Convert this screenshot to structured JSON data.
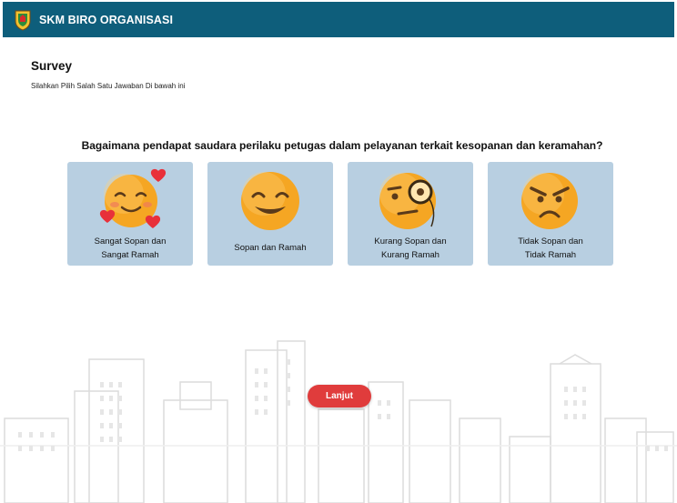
{
  "header": {
    "title": "SKM BIRO ORGANISASI",
    "logo_icon": "shield-logo-icon",
    "background": "#0e5e7b"
  },
  "survey": {
    "title": "Survey",
    "subtitle": "Silahkan Pilih Salah Satu Jawaban Di bawah ini",
    "question": "Bagaimana pendapat saudara perilaku petugas dalam pelayanan terkait kesopanan dan keramahan?"
  },
  "options": [
    {
      "line1": "Sangat Sopan dan",
      "line2": "Sangat Ramah",
      "icon": "smiling-face-with-hearts-icon"
    },
    {
      "line1": "Sopan dan Ramah",
      "icon": "smiling-face-icon"
    },
    {
      "line1": "Kurang Sopan dan",
      "line2": "Kurang Ramah",
      "icon": "face-with-monocle-icon"
    },
    {
      "line1": "Tidak Sopan dan",
      "line2": "Tidak Ramah",
      "icon": "angry-face-icon"
    }
  ],
  "next_button": {
    "label": "Lanjut",
    "color": "#e03c3c"
  },
  "colors": {
    "card": "#b8cfe1",
    "emoji": "#f5a623",
    "skyline": "#dcdcdc"
  }
}
